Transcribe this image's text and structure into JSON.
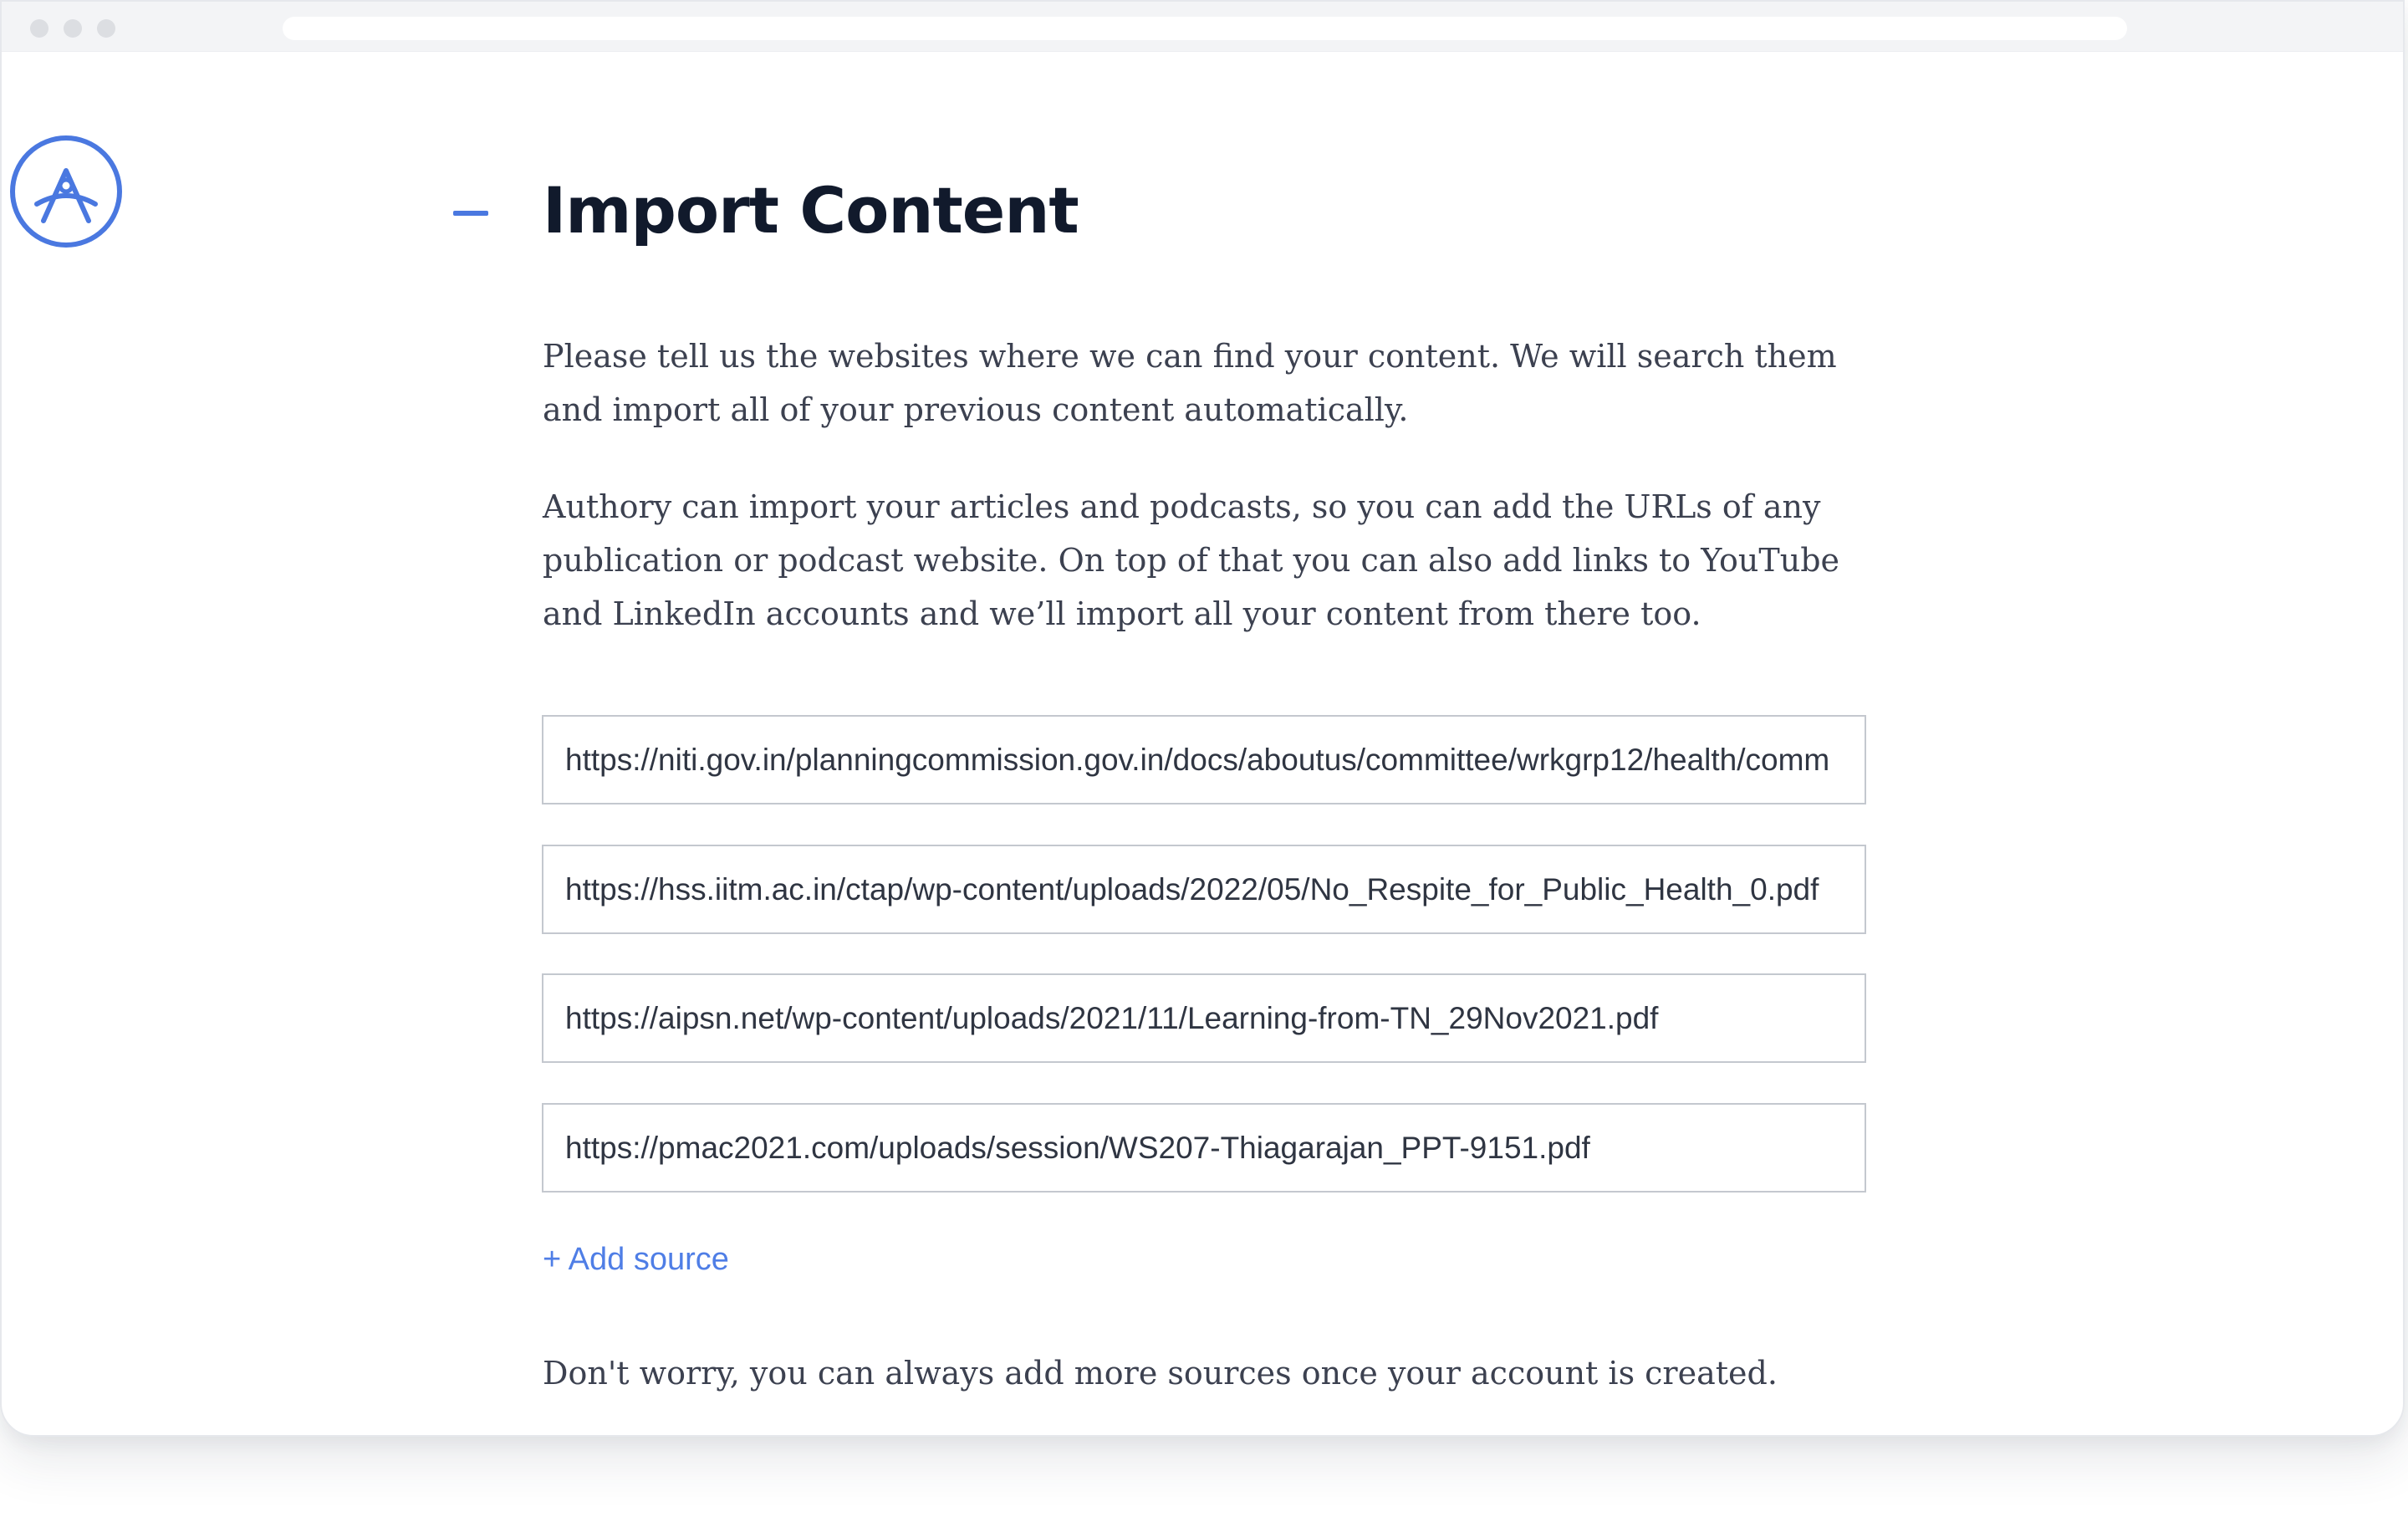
{
  "colors": {
    "accent": "#4a78e0",
    "link": "#4f7ee6",
    "title": "#111a2c",
    "body_text": "#3c4150",
    "field_border": "#c4c8cf"
  },
  "logo": {
    "icon": "authory-a-logo-icon"
  },
  "section": {
    "toggle_icon": "minus-icon",
    "title": "Import Content",
    "intro": "Please tell us the websites where we can find your content. We will search them and import all of your previous content automatically.",
    "details": "Authory can import your articles and podcasts, so you can add the URLs of any publication or podcast website. On top of that you can also add links to YouTube and LinkedIn accounts and we’ll import all your content from there too."
  },
  "sources": [
    {
      "value": "https://niti.gov.in/planningcommission.gov.in/docs/aboutus/committee/wrkgrp12/health/comm"
    },
    {
      "value": "https://hss.iitm.ac.in/ctap/wp-content/uploads/2022/05/No_Respite_for_Public_Health_0.pdf"
    },
    {
      "value": "https://aipsn.net/wp-content/uploads/2021/11/Learning-from-TN_29Nov2021.pdf"
    },
    {
      "value": "https://pmac2021.com/uploads/session/WS207-Thiagarajan_PPT-9151.pdf"
    }
  ],
  "add_source_label": "+ Add source",
  "footnote": "Don't worry, you can always add more sources once your account is created."
}
